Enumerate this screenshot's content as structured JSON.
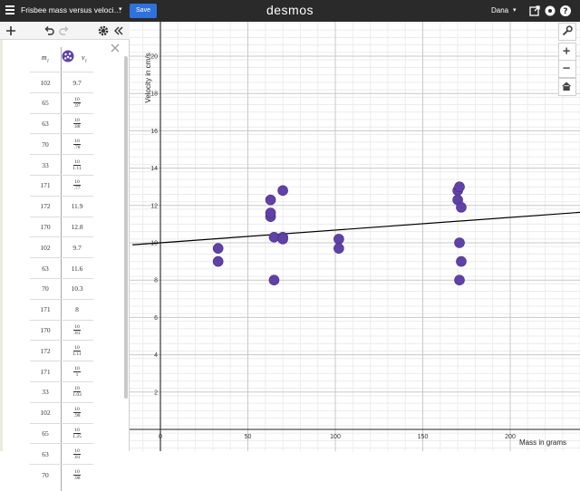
{
  "topbar": {
    "graph_title": "Frisbee mass versus veloci…",
    "save_label": "Save",
    "logo": "desmos",
    "user_name": "Dana"
  },
  "table": {
    "col1_var": "m",
    "col1_sub": "1",
    "col2_var": "v",
    "col2_sub": "1",
    "rows": [
      {
        "m": "102",
        "v": "9.7"
      },
      {
        "m": "65",
        "v_num": "10",
        "v_den": ".97"
      },
      {
        "m": "63",
        "v_num": "10",
        "v_den": ".88"
      },
      {
        "m": "70",
        "v_num": "10",
        "v_den": ".78"
      },
      {
        "m": "33",
        "v_num": "10",
        "v_den": "1.11"
      },
      {
        "m": "171",
        "v_num": "10",
        "v_den": ".77"
      },
      {
        "m": "172",
        "v": "11.9"
      },
      {
        "m": "170",
        "v": "12.8"
      },
      {
        "m": "102",
        "v": "9.7"
      },
      {
        "m": "63",
        "v": "11.6"
      },
      {
        "m": "70",
        "v": "10.3"
      },
      {
        "m": "171",
        "v": "8"
      },
      {
        "m": "170",
        "v_num": "10",
        "v_den": ".81"
      },
      {
        "m": "172",
        "v_num": "10",
        "v_den": "1.11"
      },
      {
        "m": "171",
        "v_num": "10",
        "v_den": "1"
      },
      {
        "m": "33",
        "v_num": "10",
        "v_den": "1.03"
      },
      {
        "m": "102",
        "v_num": "10",
        "v_den": ".98"
      },
      {
        "m": "65",
        "v_num": "10",
        "v_den": "1.25"
      },
      {
        "m": "63",
        "v_num": "10",
        "v_den": ".81"
      },
      {
        "m": "70",
        "v_num": "10",
        "v_den": ".98"
      }
    ]
  },
  "chart_data": {
    "type": "scatter",
    "xlabel": "Mass in grams",
    "ylabel": "Velocity in cm/s",
    "xlim": [
      -16,
      240
    ],
    "ylim": [
      -1,
      22
    ],
    "x_ticks": [
      0,
      50,
      100,
      150,
      200
    ],
    "y_ticks": [
      2,
      4,
      6,
      8,
      10,
      12,
      14,
      16,
      18,
      20
    ],
    "grid": true,
    "point_color": "#6042a6",
    "line_color": "#000000",
    "points": [
      {
        "x": 33,
        "y": 9.0
      },
      {
        "x": 33,
        "y": 9.7
      },
      {
        "x": 63,
        "y": 11.4
      },
      {
        "x": 63,
        "y": 11.6
      },
      {
        "x": 63,
        "y": 12.3
      },
      {
        "x": 65,
        "y": 10.3
      },
      {
        "x": 65,
        "y": 8.0
      },
      {
        "x": 70,
        "y": 12.8
      },
      {
        "x": 70,
        "y": 10.3
      },
      {
        "x": 70,
        "y": 10.2
      },
      {
        "x": 102,
        "y": 10.2
      },
      {
        "x": 102,
        "y": 9.7
      },
      {
        "x": 170,
        "y": 12.8
      },
      {
        "x": 170,
        "y": 12.3
      },
      {
        "x": 171,
        "y": 13.0
      },
      {
        "x": 171,
        "y": 10.0
      },
      {
        "x": 171,
        "y": 8.0
      },
      {
        "x": 172,
        "y": 11.9
      },
      {
        "x": 172,
        "y": 9.0
      }
    ],
    "regression": {
      "slope": 0.0068,
      "intercept": 10.0
    }
  }
}
